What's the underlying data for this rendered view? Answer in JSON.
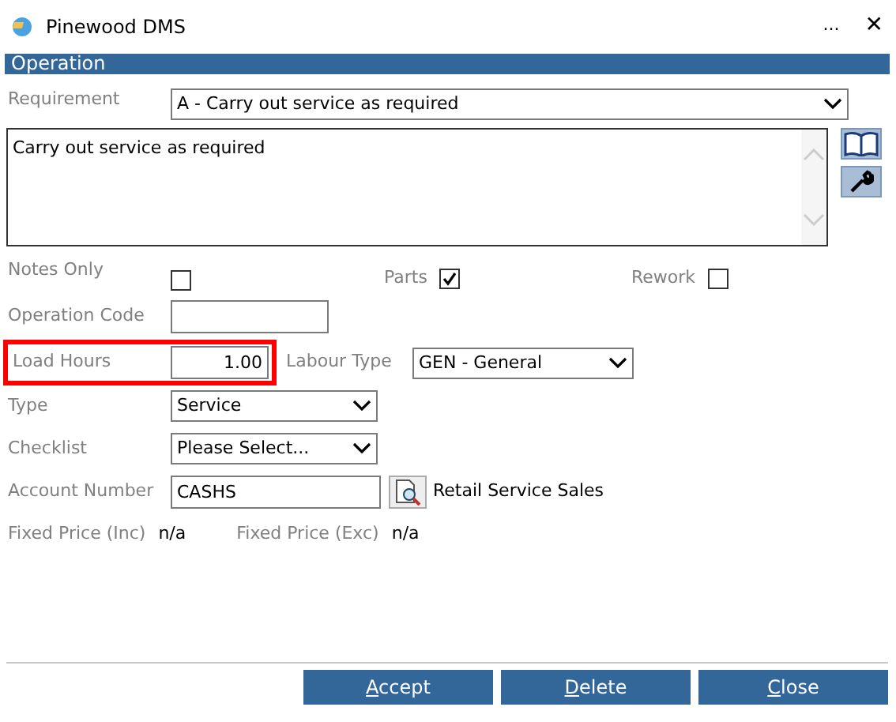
{
  "window": {
    "title": "Pinewood DMS",
    "more": "...",
    "close": "✕"
  },
  "section": {
    "title": "Operation"
  },
  "requirement": {
    "label": "Requirement",
    "value": "A - Carry out service as required"
  },
  "description": {
    "value": "Carry out service as required"
  },
  "checkboxes": [
    {
      "label": "Notes Only",
      "checked": false
    },
    {
      "label": "Parts",
      "checked": true
    },
    {
      "label": "Rework",
      "checked": false
    }
  ],
  "operation_code": {
    "label": "Operation Code"
  },
  "load_hours": {
    "label": "Load Hours",
    "value": "1.00",
    "highlighted": true
  },
  "labour_type": {
    "label": "Labour Type",
    "value": "GEN - General"
  },
  "type": {
    "label": "Type",
    "value": "Service"
  },
  "checklist": {
    "label": "Checklist",
    "value": "Please Select..."
  },
  "account": {
    "label": "Account Number",
    "value": "CASHS",
    "name": "Retail Service Sales"
  },
  "prices": [
    {
      "label": "Fixed Price (Inc)",
      "value": "n/a"
    },
    {
      "label": "Fixed Price (Exc)",
      "value": "n/a"
    }
  ],
  "buttons": [
    {
      "label": "Accept",
      "mnemonic": true
    },
    {
      "label": "Delete",
      "mnemonic": true
    },
    {
      "label": "Close",
      "mnemonic": true
    }
  ]
}
